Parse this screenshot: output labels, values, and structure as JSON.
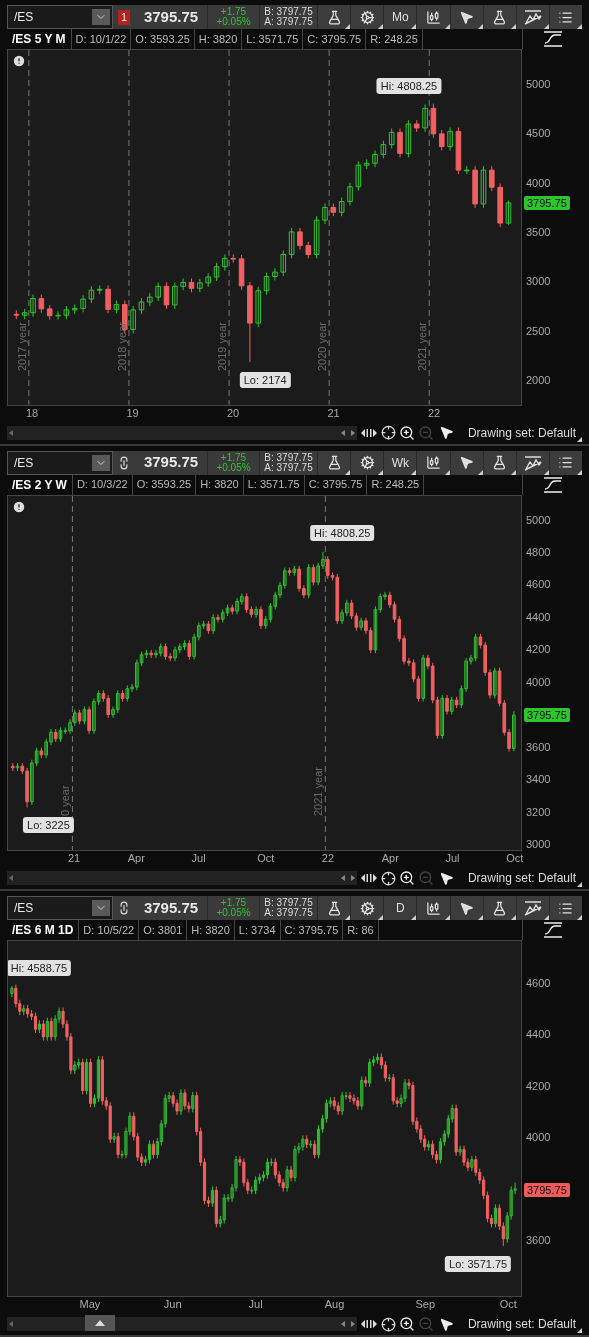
{
  "panels": [
    {
      "toolbar": {
        "symbol": "/ES",
        "link": {
          "kind": "badge",
          "text": "1"
        },
        "price": "3795.75",
        "change": "+1.75",
        "change_pct": "+0.05%",
        "bid": "B: 3797.75",
        "ask": "A: 3797.75",
        "aggregation": "Mo"
      },
      "info": {
        "title": "/ES 5 Y M",
        "fields": [
          "D: 10/1/22",
          "O: 3593.25",
          "H: 3820",
          "L: 3571.75",
          "C: 3795.75",
          "R: 248.25"
        ]
      },
      "alert": true,
      "chart_data": {
        "type": "candlestick",
        "ylim": [
          1738,
          5355
        ],
        "yticks": [
          2000,
          2500,
          3000,
          3500,
          4000,
          4500,
          5000
        ],
        "categories": [
          null,
          null,
          "18",
          null,
          null,
          null,
          null,
          null,
          null,
          null,
          null,
          null,
          null,
          null,
          "19",
          null,
          null,
          null,
          null,
          null,
          null,
          null,
          null,
          null,
          null,
          null,
          "20",
          null,
          null,
          null,
          null,
          null,
          null,
          null,
          null,
          null,
          null,
          null,
          "21",
          null,
          null,
          null,
          null,
          null,
          null,
          null,
          null,
          null,
          null,
          null,
          "22",
          null,
          null,
          null,
          null,
          null,
          null,
          null,
          null,
          null
        ],
        "ohlc": [
          [
            2660,
            2700,
            2610,
            2650
          ],
          [
            2650,
            2715,
            2610,
            2675
          ],
          [
            2675,
            2860,
            2635,
            2820
          ],
          [
            2820,
            2860,
            2675,
            2715
          ],
          [
            2715,
            2755,
            2605,
            2645
          ],
          [
            2645,
            2690,
            2605,
            2650
          ],
          [
            2650,
            2745,
            2610,
            2705
          ],
          [
            2705,
            2760,
            2665,
            2720
          ],
          [
            2720,
            2855,
            2680,
            2815
          ],
          [
            2815,
            2945,
            2775,
            2905
          ],
          [
            2905,
            2955,
            2865,
            2915
          ],
          [
            2915,
            2955,
            2670,
            2710
          ],
          [
            2710,
            2800,
            2670,
            2760
          ],
          [
            2760,
            2800,
            2465,
            2505
          ],
          [
            2505,
            2745,
            2465,
            2705
          ],
          [
            2705,
            2825,
            2665,
            2785
          ],
          [
            2785,
            2875,
            2745,
            2835
          ],
          [
            2835,
            2985,
            2795,
            2945
          ],
          [
            2945,
            2985,
            2715,
            2755
          ],
          [
            2755,
            2985,
            2715,
            2945
          ],
          [
            2945,
            3025,
            2905,
            2985
          ],
          [
            2985,
            3025,
            2885,
            2925
          ],
          [
            2925,
            3020,
            2885,
            2980
          ],
          [
            2980,
            3080,
            2940,
            3040
          ],
          [
            3040,
            3185,
            3000,
            3145
          ],
          [
            3145,
            3270,
            3105,
            3230
          ],
          [
            3230,
            3270,
            3185,
            3225
          ],
          [
            3225,
            3265,
            2910,
            2950
          ],
          [
            2950,
            2990,
            2174,
            2570
          ],
          [
            2570,
            2940,
            2530,
            2900
          ],
          [
            2900,
            3085,
            2860,
            3045
          ],
          [
            3045,
            3130,
            3005,
            3090
          ],
          [
            3090,
            3310,
            3050,
            3270
          ],
          [
            3270,
            3540,
            3230,
            3500
          ],
          [
            3500,
            3540,
            3320,
            3360
          ],
          [
            3360,
            3400,
            3230,
            3270
          ],
          [
            3270,
            3660,
            3230,
            3620
          ],
          [
            3620,
            3790,
            3580,
            3750
          ],
          [
            3750,
            3790,
            3660,
            3700
          ],
          [
            3700,
            3850,
            3660,
            3810
          ],
          [
            3810,
            4000,
            3770,
            3960
          ],
          [
            3960,
            4220,
            3920,
            4180
          ],
          [
            4180,
            4240,
            4140,
            4200
          ],
          [
            4200,
            4330,
            4160,
            4290
          ],
          [
            4290,
            4430,
            4250,
            4390
          ],
          [
            4390,
            4555,
            4350,
            4515
          ],
          [
            4515,
            4555,
            4260,
            4300
          ],
          [
            4300,
            4640,
            4260,
            4600
          ],
          [
            4600,
            4640,
            4520,
            4560
          ],
          [
            4560,
            4800,
            4520,
            4760
          ],
          [
            4760,
            4808,
            4460,
            4500
          ],
          [
            4500,
            4540,
            4330,
            4370
          ],
          [
            4370,
            4565,
            4330,
            4525
          ],
          [
            4525,
            4565,
            4090,
            4130
          ],
          [
            4130,
            4170,
            4090,
            4130
          ],
          [
            4130,
            4170,
            3745,
            3785
          ],
          [
            3785,
            4170,
            3745,
            4130
          ],
          [
            4130,
            4170,
            3915,
            3955
          ],
          [
            3955,
            3995,
            3550,
            3590
          ],
          [
            3590,
            3820,
            3572,
            3796
          ]
        ]
      },
      "chart": {
        "period_labels": [
          "2017 year",
          "2018 year",
          "2019 year",
          "2020 year",
          "2021 year"
        ],
        "high_label": "Hi: 4808.25",
        "low_label": "Lo: 2174",
        "last_price": {
          "text": "3795.75",
          "color": "#2fc42f"
        }
      },
      "footer": {
        "drawing_set": "Drawing set: Default"
      }
    },
    {
      "toolbar": {
        "symbol": "/ES",
        "link": {
          "kind": "chain"
        },
        "price": "3795.75",
        "change": "+1.75",
        "change_pct": "+0.05%",
        "bid": "B: 3797.75",
        "ask": "A: 3797.75",
        "aggregation": "Wk"
      },
      "info": {
        "title": "/ES 2 Y W",
        "fields": [
          "D: 10/3/22",
          "O: 3593.25",
          "H: 3820",
          "L: 3571.75",
          "C: 3795.75",
          "R: 248.25"
        ]
      },
      "alert": true,
      "chart_data": {
        "type": "candlestick",
        "ylim": [
          2957,
          5153
        ],
        "yticks": [
          3000,
          3200,
          3400,
          3600,
          4000,
          4200,
          4400,
          4600,
          4800,
          5000
        ],
        "categories": [
          null,
          null,
          null,
          null,
          null,
          null,
          null,
          null,
          null,
          null,
          null,
          null,
          null,
          "21",
          null,
          null,
          null,
          null,
          null,
          null,
          null,
          null,
          null,
          null,
          null,
          null,
          "Apr",
          null,
          null,
          null,
          null,
          null,
          null,
          null,
          null,
          null,
          null,
          null,
          null,
          "Jul",
          null,
          null,
          null,
          null,
          null,
          null,
          null,
          null,
          null,
          null,
          null,
          null,
          null,
          "Oct",
          null,
          null,
          null,
          null,
          null,
          null,
          null,
          null,
          null,
          null,
          null,
          null,
          "22",
          null,
          null,
          null,
          null,
          null,
          null,
          null,
          null,
          null,
          null,
          null,
          null,
          "Apr",
          null,
          null,
          null,
          null,
          null,
          null,
          null,
          null,
          null,
          null,
          null,
          null,
          "Jul",
          null,
          null,
          null,
          null,
          null,
          null,
          null,
          null,
          null,
          null,
          null,
          null,
          "Oct"
        ],
        "ohlc": [
          [
            3480,
            3500,
            3450,
            3470
          ],
          [
            3470,
            3500,
            3450,
            3480
          ],
          [
            3480,
            3500,
            3430,
            3450
          ],
          [
            3450,
            3470,
            3225,
            3260
          ],
          [
            3260,
            3520,
            3240,
            3500
          ],
          [
            3500,
            3595,
            3480,
            3575
          ],
          [
            3575,
            3595,
            3530,
            3550
          ],
          [
            3550,
            3650,
            3530,
            3630
          ],
          [
            3630,
            3710,
            3610,
            3690
          ],
          [
            3690,
            3710,
            3630,
            3650
          ],
          [
            3650,
            3720,
            3630,
            3700
          ],
          [
            3700,
            3720,
            3680,
            3700
          ],
          [
            3700,
            3770,
            3680,
            3750
          ],
          [
            3750,
            3830,
            3730,
            3810
          ],
          [
            3810,
            3830,
            3740,
            3760
          ],
          [
            3760,
            3850,
            3740,
            3830
          ],
          [
            3830,
            3850,
            3680,
            3700
          ],
          [
            3700,
            3900,
            3680,
            3880
          ],
          [
            3880,
            3950,
            3860,
            3930
          ],
          [
            3930,
            3950,
            3880,
            3900
          ],
          [
            3900,
            3920,
            3780,
            3800
          ],
          [
            3800,
            3850,
            3780,
            3830
          ],
          [
            3830,
            3950,
            3810,
            3930
          ],
          [
            3930,
            3950,
            3880,
            3900
          ],
          [
            3900,
            3980,
            3880,
            3960
          ],
          [
            3960,
            3990,
            3940,
            3970
          ],
          [
            3970,
            4140,
            3950,
            4120
          ],
          [
            4120,
            4190,
            4100,
            4170
          ],
          [
            4170,
            4200,
            4150,
            4180
          ],
          [
            4180,
            4200,
            4150,
            4170
          ],
          [
            4170,
            4200,
            4150,
            4180
          ],
          [
            4180,
            4240,
            4160,
            4220
          ],
          [
            4220,
            4240,
            4140,
            4160
          ],
          [
            4160,
            4180,
            4130,
            4150
          ],
          [
            4150,
            4220,
            4130,
            4200
          ],
          [
            4200,
            4240,
            4180,
            4220
          ],
          [
            4220,
            4260,
            4200,
            4240
          ],
          [
            4240,
            4260,
            4140,
            4160
          ],
          [
            4160,
            4300,
            4140,
            4280
          ],
          [
            4280,
            4370,
            4260,
            4350
          ],
          [
            4350,
            4380,
            4330,
            4360
          ],
          [
            4360,
            4380,
            4300,
            4320
          ],
          [
            4320,
            4420,
            4300,
            4400
          ],
          [
            4400,
            4420,
            4370,
            4390
          ],
          [
            4390,
            4450,
            4370,
            4430
          ],
          [
            4430,
            4480,
            4410,
            4460
          ],
          [
            4460,
            4480,
            4420,
            4440
          ],
          [
            4440,
            4520,
            4420,
            4500
          ],
          [
            4500,
            4550,
            4480,
            4530
          ],
          [
            4530,
            4550,
            4430,
            4450
          ],
          [
            4450,
            4470,
            4400,
            4420
          ],
          [
            4420,
            4470,
            4400,
            4450
          ],
          [
            4450,
            4470,
            4330,
            4350
          ],
          [
            4350,
            4410,
            4330,
            4390
          ],
          [
            4390,
            4490,
            4370,
            4470
          ],
          [
            4470,
            4560,
            4450,
            4540
          ],
          [
            4540,
            4620,
            4520,
            4600
          ],
          [
            4600,
            4710,
            4580,
            4690
          ],
          [
            4690,
            4710,
            4660,
            4680
          ],
          [
            4680,
            4720,
            4660,
            4700
          ],
          [
            4700,
            4720,
            4560,
            4580
          ],
          [
            4580,
            4600,
            4520,
            4540
          ],
          [
            4540,
            4730,
            4520,
            4710
          ],
          [
            4710,
            4730,
            4600,
            4620
          ],
          [
            4620,
            4740,
            4600,
            4720
          ],
          [
            4720,
            4808,
            4700,
            4760
          ],
          [
            4760,
            4780,
            4640,
            4660
          ],
          [
            4660,
            4680,
            4630,
            4650
          ],
          [
            4650,
            4670,
            4360,
            4380
          ],
          [
            4380,
            4450,
            4360,
            4430
          ],
          [
            4430,
            4510,
            4410,
            4490
          ],
          [
            4490,
            4510,
            4390,
            4410
          ],
          [
            4410,
            4430,
            4320,
            4340
          ],
          [
            4340,
            4400,
            4320,
            4380
          ],
          [
            4380,
            4400,
            4300,
            4320
          ],
          [
            4320,
            4340,
            4180,
            4200
          ],
          [
            4200,
            4470,
            4180,
            4450
          ],
          [
            4450,
            4550,
            4430,
            4530
          ],
          [
            4530,
            4560,
            4510,
            4540
          ],
          [
            4540,
            4560,
            4460,
            4480
          ],
          [
            4480,
            4500,
            4370,
            4390
          ],
          [
            4390,
            4410,
            4250,
            4270
          ],
          [
            4270,
            4290,
            4110,
            4130
          ],
          [
            4130,
            4150,
            4100,
            4120
          ],
          [
            4120,
            4140,
            4000,
            4020
          ],
          [
            4020,
            4040,
            3880,
            3900
          ],
          [
            3900,
            4170,
            3880,
            4150
          ],
          [
            4150,
            4170,
            4080,
            4100
          ],
          [
            4100,
            4120,
            3870,
            3890
          ],
          [
            3890,
            3910,
            3650,
            3670
          ],
          [
            3670,
            3920,
            3650,
            3900
          ],
          [
            3900,
            3920,
            3800,
            3820
          ],
          [
            3820,
            3910,
            3800,
            3890
          ],
          [
            3890,
            3910,
            3840,
            3860
          ],
          [
            3860,
            3980,
            3840,
            3960
          ],
          [
            3960,
            4150,
            3940,
            4130
          ],
          [
            4130,
            4170,
            4110,
            4150
          ],
          [
            4150,
            4300,
            4130,
            4280
          ],
          [
            4280,
            4300,
            4210,
            4230
          ],
          [
            4230,
            4250,
            4040,
            4060
          ],
          [
            4060,
            4080,
            3900,
            3920
          ],
          [
            3920,
            4090,
            3900,
            4070
          ],
          [
            4070,
            4090,
            3850,
            3870
          ],
          [
            3870,
            3890,
            3670,
            3690
          ],
          [
            3690,
            3710,
            3570,
            3590
          ],
          [
            3590,
            3820,
            3572,
            3796
          ]
        ]
      },
      "chart": {
        "period_labels": [
          "0 year",
          "2021 year"
        ],
        "high_label": "Hi: 4808.25",
        "low_label": "Lo: 3225",
        "last_price": {
          "text": "3795.75",
          "color": "#2fc42f"
        }
      },
      "footer": {
        "drawing_set": "Drawing set: Default"
      }
    },
    {
      "toolbar": {
        "symbol": "/ES",
        "link": {
          "kind": "chain"
        },
        "price": "3795.75",
        "change": "+1.75",
        "change_pct": "+0.05%",
        "bid": "B: 3797.75",
        "ask": "A: 3797.75",
        "aggregation": "D"
      },
      "info": {
        "title": "/ES 6 M 1D",
        "fields": [
          "D: 10/5/22",
          "O: 3801",
          "H: 3820",
          "L: 3734",
          "C: 3795.75",
          "R: 86"
        ]
      },
      "scroll_handle": true,
      "chart_data": {
        "type": "candlestick",
        "ylim": [
          3378,
          4765
        ],
        "yticks": [
          3600,
          4000,
          4200,
          4400,
          4600
        ],
        "categories": [
          null,
          null,
          null,
          null,
          null,
          null,
          null,
          null,
          null,
          null,
          null,
          null,
          null,
          null,
          null,
          null,
          null,
          null,
          null,
          null,
          "May",
          null,
          null,
          null,
          null,
          null,
          null,
          null,
          null,
          null,
          null,
          null,
          null,
          null,
          null,
          null,
          null,
          null,
          null,
          null,
          null,
          "Jun",
          null,
          null,
          null,
          null,
          null,
          null,
          null,
          null,
          null,
          null,
          null,
          null,
          null,
          null,
          null,
          null,
          null,
          null,
          null,
          null,
          "Jul",
          null,
          null,
          null,
          null,
          null,
          null,
          null,
          null,
          null,
          null,
          null,
          null,
          null,
          null,
          null,
          null,
          null,
          null,
          null,
          "Aug",
          null,
          null,
          null,
          null,
          null,
          null,
          null,
          null,
          null,
          null,
          null,
          null,
          null,
          null,
          null,
          null,
          null,
          null,
          null,
          null,
          null,
          null,
          "Sep",
          null,
          null,
          null,
          null,
          null,
          null,
          null,
          null,
          null,
          null,
          null,
          null,
          null,
          null,
          null,
          null,
          null,
          null,
          null,
          null,
          "Oct",
          null,
          null
        ],
        "ohlc": [
          [
            4560,
            4589,
            4545,
            4580
          ],
          [
            4580,
            4595,
            4505,
            4520
          ],
          [
            4520,
            4535,
            4475,
            4490
          ],
          [
            4490,
            4515,
            4475,
            4500
          ],
          [
            4500,
            4515,
            4465,
            4480
          ],
          [
            4480,
            4495,
            4455,
            4470
          ],
          [
            4470,
            4485,
            4405,
            4420
          ],
          [
            4420,
            4455,
            4405,
            4440
          ],
          [
            4440,
            4455,
            4375,
            4390
          ],
          [
            4390,
            4465,
            4375,
            4450
          ],
          [
            4450,
            4465,
            4375,
            4390
          ],
          [
            4390,
            4475,
            4375,
            4460
          ],
          [
            4460,
            4505,
            4445,
            4490
          ],
          [
            4490,
            4505,
            4425,
            4440
          ],
          [
            4440,
            4455,
            4375,
            4390
          ],
          [
            4390,
            4405,
            4245,
            4260
          ],
          [
            4260,
            4295,
            4245,
            4280
          ],
          [
            4280,
            4305,
            4265,
            4290
          ],
          [
            4290,
            4305,
            4165,
            4180
          ],
          [
            4180,
            4305,
            4165,
            4290
          ],
          [
            4290,
            4305,
            4115,
            4130
          ],
          [
            4130,
            4165,
            4115,
            4150
          ],
          [
            4150,
            4315,
            4135,
            4300
          ],
          [
            4300,
            4315,
            4125,
            4140
          ],
          [
            4140,
            4155,
            4105,
            4120
          ],
          [
            4120,
            4135,
            3975,
            3990
          ],
          [
            3990,
            4015,
            3975,
            4000
          ],
          [
            4000,
            4015,
            3915,
            3930
          ],
          [
            3930,
            3945,
            3915,
            3930
          ],
          [
            3930,
            4035,
            3915,
            4020
          ],
          [
            4020,
            4095,
            4005,
            4080
          ],
          [
            4080,
            4095,
            3985,
            4000
          ],
          [
            4000,
            4015,
            3905,
            3920
          ],
          [
            3920,
            3935,
            3885,
            3900
          ],
          [
            3900,
            3925,
            3885,
            3910
          ],
          [
            3910,
            3985,
            3895,
            3970
          ],
          [
            3970,
            3985,
            3915,
            3930
          ],
          [
            3930,
            3995,
            3915,
            3980
          ],
          [
            3980,
            4065,
            3965,
            4050
          ],
          [
            4050,
            4165,
            4035,
            4150
          ],
          [
            4150,
            4175,
            4135,
            4160
          ],
          [
            4160,
            4175,
            4115,
            4130
          ],
          [
            4130,
            4145,
            4085,
            4100
          ],
          [
            4100,
            4185,
            4085,
            4170
          ],
          [
            4170,
            4185,
            4105,
            4120
          ],
          [
            4120,
            4135,
            4095,
            4110
          ],
          [
            4110,
            4175,
            4095,
            4160
          ],
          [
            4160,
            4175,
            4005,
            4020
          ],
          [
            4020,
            4035,
            3885,
            3900
          ],
          [
            3900,
            3915,
            3735,
            3750
          ],
          [
            3750,
            3765,
            3725,
            3740
          ],
          [
            3740,
            3805,
            3725,
            3790
          ],
          [
            3790,
            3805,
            3645,
            3660
          ],
          [
            3660,
            3690,
            3645,
            3675
          ],
          [
            3675,
            3775,
            3660,
            3760
          ],
          [
            3760,
            3775,
            3745,
            3760
          ],
          [
            3760,
            3815,
            3745,
            3800
          ],
          [
            3800,
            3925,
            3785,
            3910
          ],
          [
            3910,
            3925,
            3885,
            3900
          ],
          [
            3900,
            3915,
            3805,
            3820
          ],
          [
            3820,
            3835,
            3775,
            3790
          ],
          [
            3790,
            3805,
            3775,
            3790
          ],
          [
            3790,
            3845,
            3775,
            3830
          ],
          [
            3830,
            3855,
            3815,
            3840
          ],
          [
            3840,
            3865,
            3825,
            3850
          ],
          [
            3850,
            3915,
            3835,
            3900
          ],
          [
            3900,
            3915,
            3885,
            3900
          ],
          [
            3900,
            3915,
            3835,
            3850
          ],
          [
            3850,
            3865,
            3805,
            3820
          ],
          [
            3820,
            3835,
            3785,
            3800
          ],
          [
            3800,
            3885,
            3785,
            3870
          ],
          [
            3870,
            3885,
            3825,
            3840
          ],
          [
            3840,
            3965,
            3825,
            3950
          ],
          [
            3950,
            3975,
            3935,
            3960
          ],
          [
            3960,
            4005,
            3945,
            3990
          ],
          [
            3990,
            4005,
            3955,
            3970
          ],
          [
            3970,
            3985,
            3955,
            3970
          ],
          [
            3970,
            3985,
            3915,
            3930
          ],
          [
            3930,
            4045,
            3915,
            4030
          ],
          [
            4030,
            4085,
            4015,
            4070
          ],
          [
            4070,
            4145,
            4055,
            4130
          ],
          [
            4130,
            4155,
            4115,
            4140
          ],
          [
            4140,
            4155,
            4105,
            4120
          ],
          [
            4120,
            4135,
            4085,
            4100
          ],
          [
            4100,
            4175,
            4085,
            4160
          ],
          [
            4160,
            4175,
            4145,
            4160
          ],
          [
            4160,
            4175,
            4135,
            4150
          ],
          [
            4150,
            4165,
            4125,
            4140
          ],
          [
            4140,
            4155,
            4105,
            4120
          ],
          [
            4120,
            4235,
            4105,
            4220
          ],
          [
            4220,
            4235,
            4195,
            4210
          ],
          [
            4210,
            4305,
            4195,
            4290
          ],
          [
            4290,
            4315,
            4275,
            4300
          ],
          [
            4300,
            4325,
            4285,
            4310
          ],
          [
            4310,
            4325,
            4265,
            4280
          ],
          [
            4280,
            4295,
            4215,
            4230
          ],
          [
            4230,
            4245,
            4215,
            4230
          ],
          [
            4230,
            4245,
            4125,
            4140
          ],
          [
            4140,
            4155,
            4115,
            4130
          ],
          [
            4130,
            4165,
            4115,
            4150
          ],
          [
            4150,
            4225,
            4135,
            4210
          ],
          [
            4210,
            4225,
            4185,
            4200
          ],
          [
            4200,
            4215,
            4045,
            4060
          ],
          [
            4060,
            4075,
            4015,
            4030
          ],
          [
            4030,
            4045,
            3975,
            3990
          ],
          [
            3990,
            4005,
            3945,
            3960
          ],
          [
            3960,
            3985,
            3945,
            3970
          ],
          [
            3970,
            3985,
            3915,
            3930
          ],
          [
            3930,
            3945,
            3895,
            3910
          ],
          [
            3910,
            3995,
            3895,
            3980
          ],
          [
            3980,
            4025,
            3965,
            4010
          ],
          [
            4010,
            4085,
            3995,
            4070
          ],
          [
            4070,
            4125,
            4055,
            4110
          ],
          [
            4110,
            4125,
            3925,
            3940
          ],
          [
            3940,
            3965,
            3925,
            3950
          ],
          [
            3950,
            3965,
            3885,
            3900
          ],
          [
            3900,
            3915,
            3865,
            3880
          ],
          [
            3880,
            3925,
            3865,
            3910
          ],
          [
            3910,
            3925,
            3845,
            3860
          ],
          [
            3860,
            3875,
            3815,
            3830
          ],
          [
            3830,
            3845,
            3755,
            3770
          ],
          [
            3770,
            3785,
            3665,
            3680
          ],
          [
            3680,
            3695,
            3645,
            3660
          ],
          [
            3660,
            3735,
            3645,
            3720
          ],
          [
            3720,
            3735,
            3635,
            3650
          ],
          [
            3650,
            3665,
            3572,
            3600
          ],
          [
            3600,
            3705,
            3585,
            3690
          ],
          [
            3690,
            3805,
            3675,
            3790
          ],
          [
            3790,
            3820,
            3775,
            3796
          ]
        ]
      },
      "chart": {
        "high_label": "Hi: 4588.75",
        "low_label": "Lo: 3571.75",
        "last_price": {
          "text": "3795.75",
          "color": "#f05a5a"
        }
      },
      "footer": {
        "drawing_set": "Drawing set: Default"
      }
    }
  ]
}
